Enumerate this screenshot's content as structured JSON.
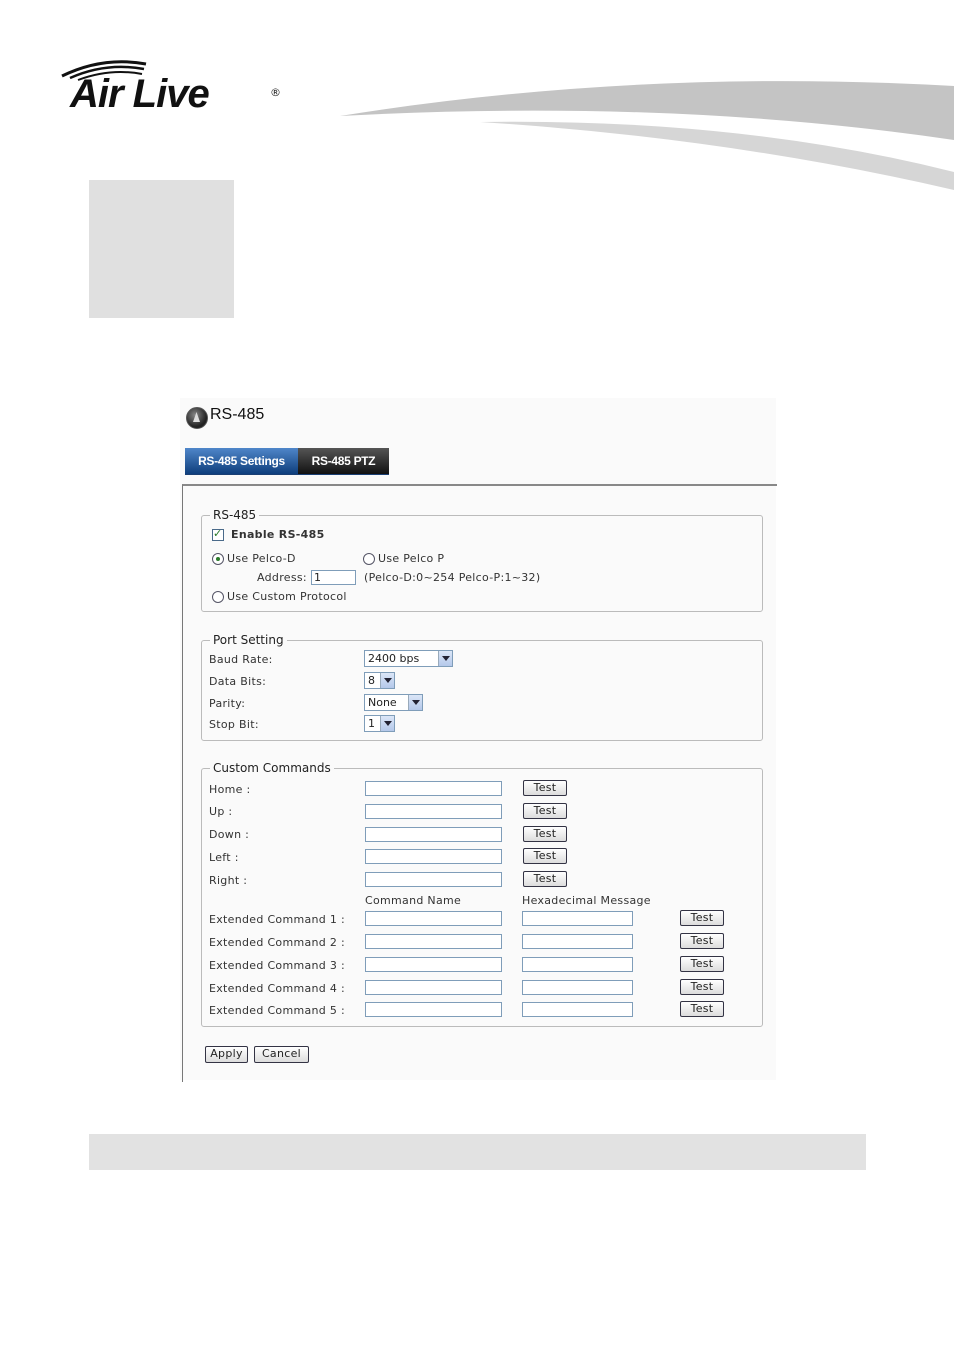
{
  "brand": {
    "logo_text": "Air Live",
    "registered": "®"
  },
  "panel": {
    "title": "RS-485",
    "tabs": [
      {
        "label": "RS-485 Settings",
        "active": true
      },
      {
        "label": "RS-485 PTZ",
        "active": false
      }
    ]
  },
  "rs485": {
    "legend": "RS-485",
    "enable_label": "Enable RS-485",
    "enable_checked": true,
    "pelco_d_label": "Use Pelco-D",
    "pelco_p_label": "Use Pelco P",
    "address_label": "Address:",
    "address_value": "1",
    "address_hint": "(Pelco-D:0~254 Pelco-P:1~32)",
    "custom_protocol_label": "Use Custom Protocol",
    "selected_protocol": "Use Pelco-D"
  },
  "port": {
    "legend": "Port Setting",
    "baud_label": "Baud Rate:",
    "baud_value": "2400 bps",
    "data_bits_label": "Data Bits:",
    "data_bits_value": "8",
    "parity_label": "Parity:",
    "parity_value": "None",
    "stop_bit_label": "Stop Bit:",
    "stop_bit_value": "1"
  },
  "custom": {
    "legend": "Custom Commands",
    "test_label": "Test",
    "basic": [
      "Home :",
      "Up :",
      "Down :",
      "Left :",
      "Right :"
    ],
    "col_name": "Command Name",
    "col_hex": "Hexadecimal Message",
    "extended": [
      "Extended Command 1 :",
      "Extended Command 2 :",
      "Extended Command 3 :",
      "Extended Command 4 :",
      "Extended Command 5 :"
    ]
  },
  "actions": {
    "apply": "Apply",
    "cancel": "Cancel"
  }
}
